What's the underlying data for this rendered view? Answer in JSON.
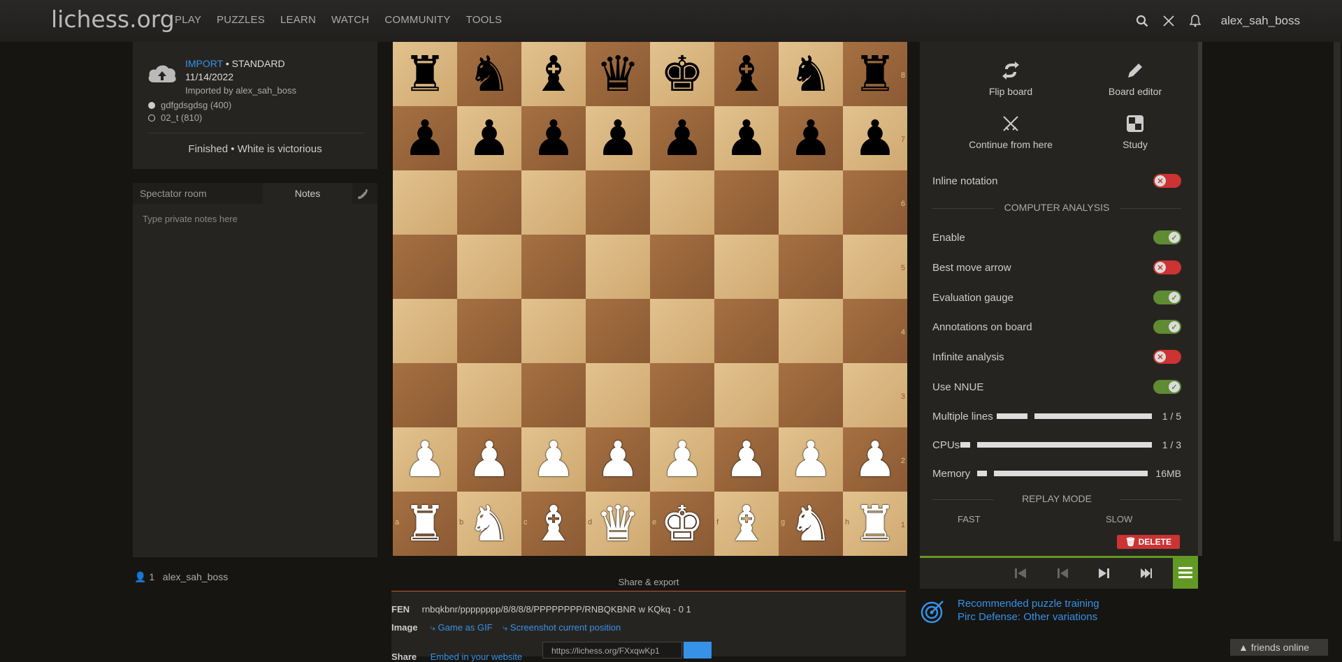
{
  "site": {
    "logo": "lichess.org"
  },
  "nav": [
    "PLAY",
    "PUZZLES",
    "LEARN",
    "WATCH",
    "COMMUNITY",
    "TOOLS"
  ],
  "user": {
    "name": "alex_sah_boss"
  },
  "game": {
    "import_label": "IMPORT",
    "variant": " • STANDARD",
    "date": "11/14/2022",
    "imported_by": "Imported by alex_sah_boss",
    "white": "gdfgdsgdsg (400)",
    "black": "02_t (810)",
    "result": "Finished • White is victorious"
  },
  "chat": {
    "tab_spectator": "Spectator room",
    "tab_notes": "Notes",
    "notes_placeholder": "Type private notes here"
  },
  "spectators": {
    "count": "1",
    "name": "alex_sah_boss"
  },
  "board": {
    "ranks": [
      "8",
      "7",
      "6",
      "5",
      "4",
      "3",
      "2",
      "1"
    ],
    "files": [
      "a",
      "b",
      "c",
      "d",
      "e",
      "f",
      "g",
      "h"
    ],
    "position": [
      [
        "r",
        "n",
        "b",
        "q",
        "k",
        "b",
        "n",
        "r"
      ],
      [
        "p",
        "p",
        "p",
        "p",
        "p",
        "p",
        "p",
        "p"
      ],
      [
        "",
        "",
        "",
        "",
        "",
        "",
        "",
        ""
      ],
      [
        "",
        "",
        "",
        "",
        "",
        "",
        "",
        ""
      ],
      [
        "",
        "",
        "",
        "",
        "",
        "",
        "",
        ""
      ],
      [
        "",
        "",
        "",
        "",
        "",
        "",
        "",
        ""
      ],
      [
        "P",
        "P",
        "P",
        "P",
        "P",
        "P",
        "P",
        "P"
      ],
      [
        "R",
        "N",
        "B",
        "Q",
        "K",
        "B",
        "N",
        "R"
      ]
    ]
  },
  "tools": {
    "flip": "Flip board",
    "editor": "Board editor",
    "continue": "Continue from here",
    "study": "Study",
    "inline_notation": "Inline notation",
    "computer_analysis": "COMPUTER ANALYSIS",
    "enable": "Enable",
    "best_move": "Best move arrow",
    "eval_gauge": "Evaluation gauge",
    "annotations": "Annotations on board",
    "infinite": "Infinite analysis",
    "nnue": "Use NNUE",
    "multiple_lines": "Multiple lines",
    "multiple_lines_val": "1 / 5",
    "cpus": "CPUs",
    "cpus_val": "1 / 3",
    "memory": "Memory",
    "memory_val": "16MB",
    "replay_mode": "REPLAY MODE",
    "fast": "FAST",
    "slow": "SLOW",
    "delete": "DELETE"
  },
  "share": {
    "header": "Share & export",
    "fen_label": "FEN",
    "fen": "rnbqkbnr/pppppppp/8/8/8/8/PPPPPPPP/RNBQKBNR w KQkq - 0 1",
    "image_label": "Image",
    "gif": "Game as GIF",
    "screenshot": "Screenshot current position",
    "share_label": "Share",
    "embed": "Embed in your website",
    "url": "https://lichess.org/FXxqwKp1"
  },
  "puzzle": {
    "line1": "Recommended puzzle training",
    "line2": "Pirc Defense: Other variations"
  },
  "friends": "friends online",
  "colors": {
    "accent": "#3692e7",
    "green": "#629924",
    "red": "#cc3333"
  }
}
